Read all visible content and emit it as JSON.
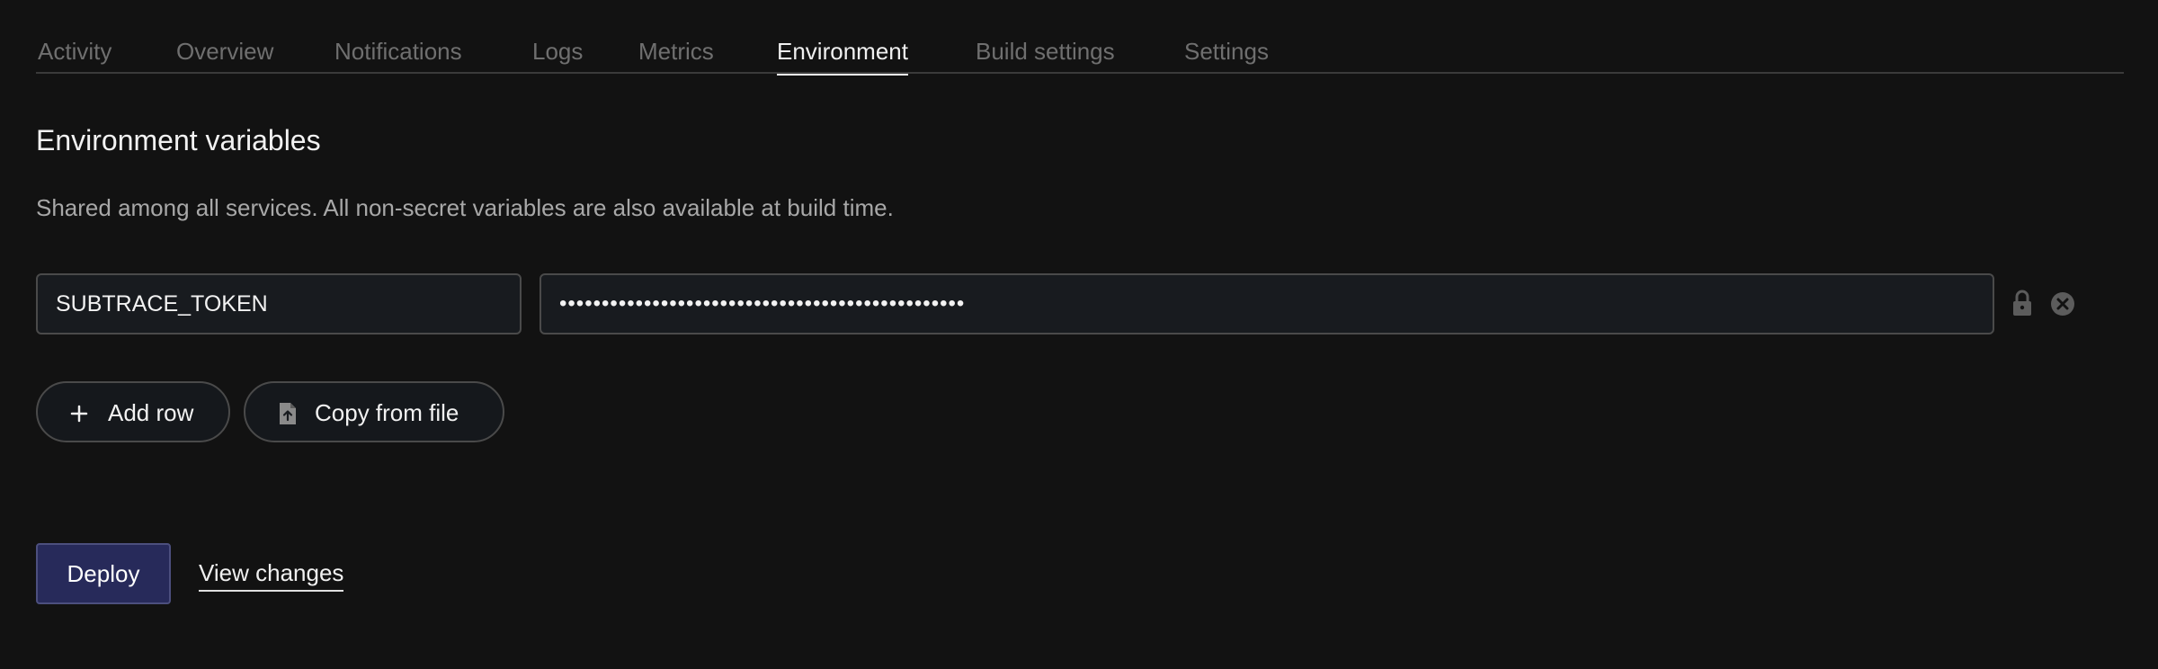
{
  "tabs": [
    {
      "label": "Activity",
      "active": false
    },
    {
      "label": "Overview",
      "active": false
    },
    {
      "label": "Notifications",
      "active": false
    },
    {
      "label": "Logs",
      "active": false
    },
    {
      "label": "Metrics",
      "active": false
    },
    {
      "label": "Environment",
      "active": true
    },
    {
      "label": "Build settings",
      "active": false
    },
    {
      "label": "Settings",
      "active": false
    }
  ],
  "env": {
    "title": "Environment variables",
    "description": "Shared among all services. All non-secret variables are also available at build time.",
    "rows": [
      {
        "key": "SUBTRACE_TOKEN",
        "value": "••••••••••••••••••••••••••••••••••••••••••••••••",
        "secret": true
      }
    ],
    "row_icons": [
      "lock-icon",
      "remove-circle-icon"
    ]
  },
  "actions": {
    "add_row_label": "Add row",
    "copy_from_file_label": "Copy from file",
    "deploy_label": "Deploy",
    "view_changes_label": "View changes"
  },
  "colors": {
    "background": "#121212",
    "accent_button": "#272a5a",
    "muted_text": "#6f6f6f",
    "field_background": "#181b1f"
  }
}
